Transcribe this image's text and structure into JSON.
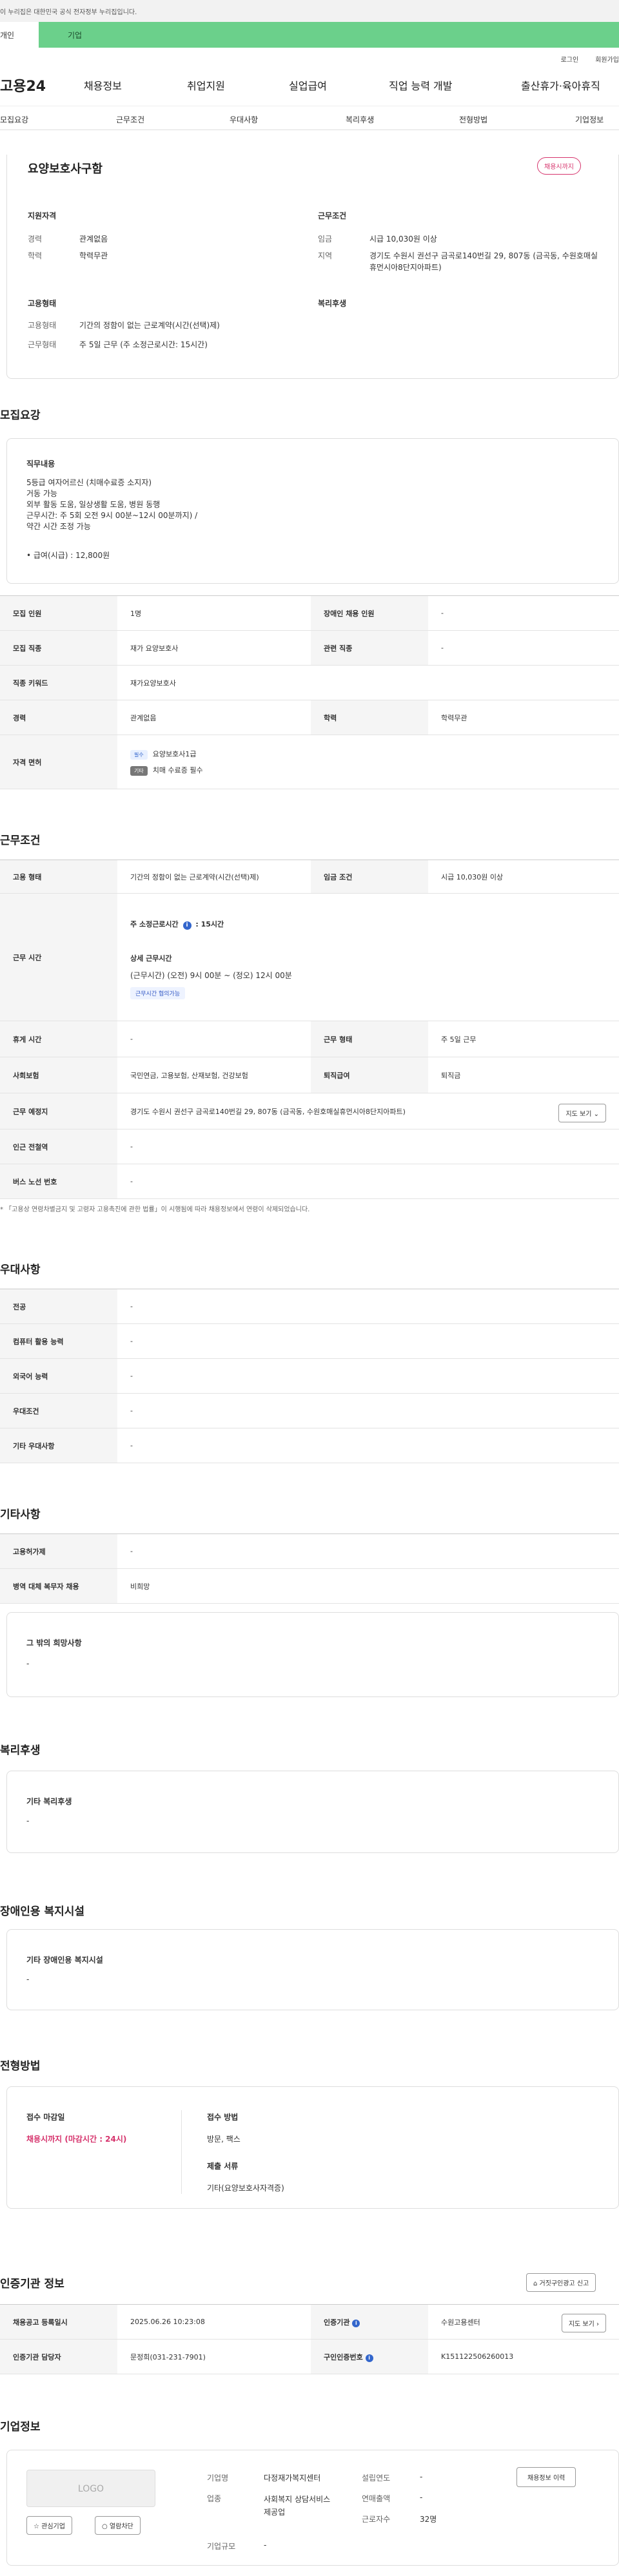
{
  "gov_banner": "이 누리집은 대한민국 공식 전자정부 누리집입니다.",
  "top_tabs": {
    "personal": "개인",
    "company": "기업"
  },
  "util": {
    "login": "로그인",
    "join": "회원가입"
  },
  "gnb": {
    "logo": "고용24",
    "menu": [
      "채용정보",
      "취업지원",
      "실업급여",
      "직업 능력 개발",
      "출산휴가·육아휴직"
    ]
  },
  "subnav": [
    "모집요강",
    "근무조건",
    "우대사항",
    "복리후생",
    "전형방법",
    "기업정보"
  ],
  "summary": {
    "title": "요양보호사구함",
    "badge": "채용시까지",
    "qual_head": "지원자격",
    "cond_head": "근무조건",
    "exp_k": "경력",
    "exp_v": "관계없음",
    "edu_k": "학력",
    "edu_v": "학력무관",
    "wage_k": "임금",
    "wage_v": "시급 10,030원 이상",
    "loc_k": "지역",
    "loc_v": "경기도 수원시 권선구 금곡로140번길 29, 807동 (금곡동, 수원호매실휴먼시아8단지아파트)",
    "emp_head": "고용형태",
    "welfare_head": "복리후생",
    "emptype_k": "고용형태",
    "emptype_v": "기간의 정함이 없는 근로계약(시간(선택)제)",
    "worktype_k": "근무형태",
    "worktype_v": "주 5일 근무 (주 소정근로시간: 15시간)"
  },
  "recruit": {
    "title": "모집요강",
    "duty_head": "직무내용",
    "duty_lines": [
      "5등급 여자어르신 (치매수료증 소지자)",
      "거동 가능",
      "외부 활동 도움, 일상생활 도움, 병원 동행",
      "근무시간: 주 5회 오전 9시 00분~12시 00분까지) /",
      "약간 시간 조정 가능"
    ],
    "wage_line": "• 급여(시급) : 12,800원",
    "table": {
      "headcount_k": "모집 인원",
      "headcount_v": "1명",
      "disabled_k": "장애인 채용 인원",
      "disabled_v": "-",
      "job_k": "모집 직종",
      "job_v": "재가 요양보호사",
      "related_k": "관련 직종",
      "related_v": "-",
      "keyword_k": "직종 키워드",
      "keyword_v": "재가요양보호사",
      "exp_k": "경력",
      "exp_v": "관계없음",
      "edu_k": "학력",
      "edu_v": "학력무관",
      "license_k": "자격 면허",
      "license_req_tag": "필수",
      "license_req": "요양보호사1급",
      "license_etc_tag": "기타",
      "license_etc": "치매 수료증 필수"
    }
  },
  "work": {
    "title": "근무조건",
    "emptype_k": "고용 형태",
    "emptype_v": "기간의 정함이 없는 근로계약(시간(선택)제)",
    "wage_k": "임금 조건",
    "wage_v": "시급 10,030원 이상",
    "time_k": "근무 시간",
    "time_sub1": "주 소정근로시간",
    "time_sub1_v": ": 15시간",
    "time_sub2": "상세 근무시간",
    "time_detail": "(근무시간) (오전) 9시 00분 ~ (정오) 12시 00분",
    "time_chip": "근무시간 협의가능",
    "rest_k": "휴게 시간",
    "rest_v": "-",
    "worktype_k": "근무 형태",
    "worktype_v": "주 5일 근무",
    "ins_k": "사회보험",
    "ins_v": "국민연금, 고용보험, 산재보험, 건강보험",
    "retire_k": "퇴직급여",
    "retire_v": "퇴직금",
    "place_k": "근무 예정지",
    "place_v": "경기도 수원시 권선구 금곡로140번길 29, 807동 (금곡동, 수원호매실휴먼시아8단지아파트)",
    "map_btn": "지도 보기",
    "subway_k": "인근 전철역",
    "subway_v": "-",
    "bus_k": "버스 노선 번호",
    "bus_v": "-",
    "note": "* 「고용상 연령차별금지 및 고령자 고용촉진에 관한 법률」이 시행됨에 따라 채용정보에서 연령이 삭제되었습니다."
  },
  "pref": {
    "title": "우대사항",
    "rows": [
      {
        "k": "전공",
        "v": "-"
      },
      {
        "k": "컴퓨터 활용 능력",
        "v": "-"
      },
      {
        "k": "외국어 능력",
        "v": "-"
      },
      {
        "k": "우대조건",
        "v": "-"
      },
      {
        "k": "기타 우대사항",
        "v": "-"
      }
    ]
  },
  "etc": {
    "title": "기타사항",
    "rows": [
      {
        "k": "고용허가제",
        "v": "-"
      },
      {
        "k": "병역 대체 복무자 채용",
        "v": "비희망"
      }
    ],
    "box_head": "그 밖의 희망사항",
    "box_v": "-"
  },
  "welfare": {
    "title": "복리후생",
    "box_head": "기타 복리후생",
    "box_v": "-"
  },
  "disabled": {
    "title": "장애인용 복지시설",
    "box_head": "기타 장애인용 복지시설",
    "box_v": "-"
  },
  "process": {
    "title": "전형방법",
    "deadline_head": "접수 마감일",
    "deadline_v": "채용시까지 (마감시간 : 24시)",
    "method_head": "접수 방법",
    "method_v": "방문, 팩스",
    "docs_head": "제출 서류",
    "docs_v": "기타(요양보호사자격증)"
  },
  "cert": {
    "title": "인증기관 정보",
    "report_btn": "거짓구인광고 신고",
    "reg_k": "채용공고 등록일시",
    "reg_v": "2025.06.26 10:23:08",
    "org_k": "인증기관",
    "org_v": "수원고용센터",
    "map_btn": "지도 보기",
    "mgr_k": "인증기관 담당자",
    "mgr_v": "문정희(031-231-7901)",
    "no_k": "구인인증번호",
    "no_v": "K151122506260013"
  },
  "company": {
    "title": "기업정보",
    "logo": "LOGO",
    "fav_btn": "관심기업",
    "block_btn": "열람차단",
    "name_k": "기업명",
    "name_v": "다정재가복지센터",
    "industry_k": "업종",
    "industry_v": "사회복지 상담서비스 제공업",
    "size_k": "기업규모",
    "size_v": "-",
    "founded_k": "설립연도",
    "founded_v": "-",
    "sales_k": "연매출액",
    "sales_v": "-",
    "staff_k": "근로자수",
    "staff_v": "32명",
    "history_btn": "채용정보 이력"
  }
}
